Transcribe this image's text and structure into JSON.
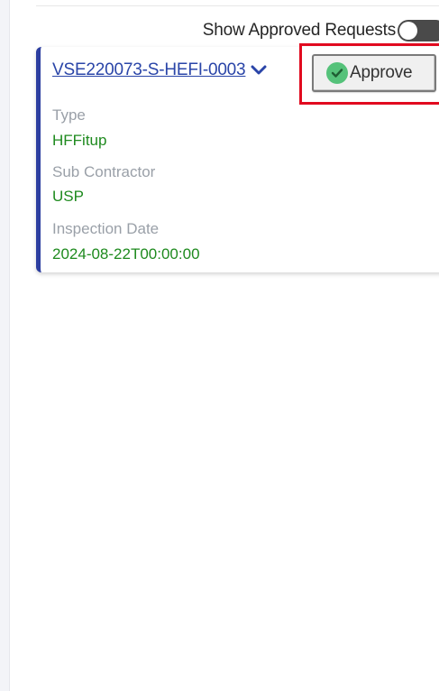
{
  "filters": {
    "show_approved_label": "Show Approved Requests",
    "show_approved_enabled": false
  },
  "request_card": {
    "request_id": "VSE220073-S-HEFI-0003",
    "expand_icon": "chevron-down-icon",
    "approve_label": "Approve",
    "approve_icon": "check-circle-icon",
    "fields": {
      "type_label": "Type",
      "type_value": "HFFitup",
      "sub_contractor_label": "Sub Contractor",
      "sub_contractor_value": "USP",
      "inspection_date_label": "Inspection Date",
      "inspection_date_value": "2024-08-22T00:00:00"
    }
  },
  "colors": {
    "card_accent": "#2c3ea0",
    "link": "#2a45a8",
    "value_text": "#1e8a1e",
    "label_text": "#9aa0a8",
    "highlight_box": "#e10a1f",
    "approve_check": "#55c27a",
    "toggle_track": "#4a4a4a"
  }
}
